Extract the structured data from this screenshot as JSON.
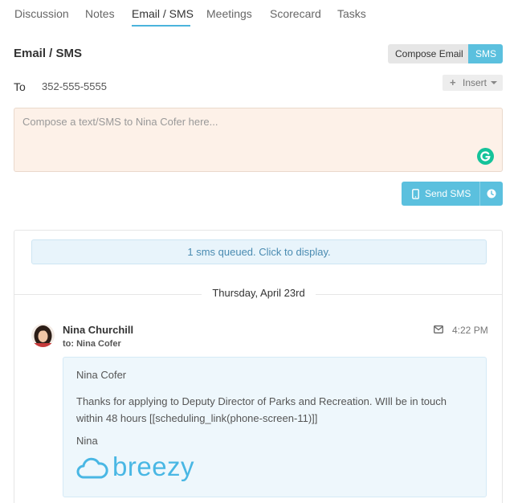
{
  "tabs": [
    {
      "label": "Discussion",
      "active": false
    },
    {
      "label": "Notes",
      "active": false
    },
    {
      "label": "Email / SMS",
      "active": true
    },
    {
      "label": "Meetings",
      "active": false
    },
    {
      "label": "Scorecard",
      "active": false
    },
    {
      "label": "Tasks",
      "active": false
    }
  ],
  "header": {
    "title": "Email / SMS",
    "compose_email_label": "Compose Email",
    "sms_label": "SMS"
  },
  "recipient": {
    "to_label": "To",
    "phone": "352-555-5555"
  },
  "insert": {
    "label": "Insert",
    "icon": "plus-icon"
  },
  "composer": {
    "placeholder": "Compose a text/SMS to Nina Cofer here...",
    "value": ""
  },
  "send": {
    "label": "Send SMS",
    "icon": "mobile-phone-icon",
    "schedule_icon": "clock-icon"
  },
  "thread": {
    "queued_text": "1 sms queued. Click to display.",
    "date": "Thursday, April 23rd",
    "messages": [
      {
        "sender": "Nina Churchill",
        "to": "to: Nina Cofer",
        "time": "4:22 PM",
        "type_icon": "envelope-icon",
        "greeting": "Nina Cofer",
        "body": "Thanks for applying to Deputy Director of Parks and Recreation. WIll be in touch within 48 hours [[scheduling_link(phone-screen-11)]]",
        "signature": "Nina",
        "logo_text": "breezy"
      }
    ]
  },
  "colors": {
    "accent": "#5bc0de",
    "tab_underline": "#4bb4dc",
    "composer_bg": "#fdf1e8",
    "message_bg": "#eef7fc",
    "grammarly": "#15c39a",
    "breezy": "#49b7e4"
  }
}
